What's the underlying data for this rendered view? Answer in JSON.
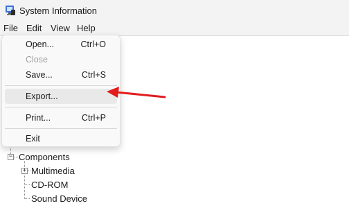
{
  "window": {
    "title": "System Information",
    "icon": "system-information-icon"
  },
  "menubar": {
    "items": [
      "File",
      "Edit",
      "View",
      "Help"
    ]
  },
  "file_menu": {
    "open": {
      "label": "Open...",
      "shortcut": "Ctrl+O"
    },
    "close": {
      "label": "Close",
      "disabled": true
    },
    "save": {
      "label": "Save...",
      "shortcut": "Ctrl+S"
    },
    "export": {
      "label": "Export...",
      "highlighted": true
    },
    "print": {
      "label": "Print...",
      "shortcut": "Ctrl+P"
    },
    "exit": {
      "label": "Exit"
    }
  },
  "tree": {
    "components": {
      "label": "Components",
      "expander": "−"
    },
    "children": [
      {
        "label": "Multimedia",
        "expander": "+"
      },
      {
        "label": "CD-ROM"
      },
      {
        "label": "Sound Device"
      }
    ]
  },
  "annotation": {
    "arrow_color": "#e11d1d",
    "icon": "red-arrow-icon"
  }
}
